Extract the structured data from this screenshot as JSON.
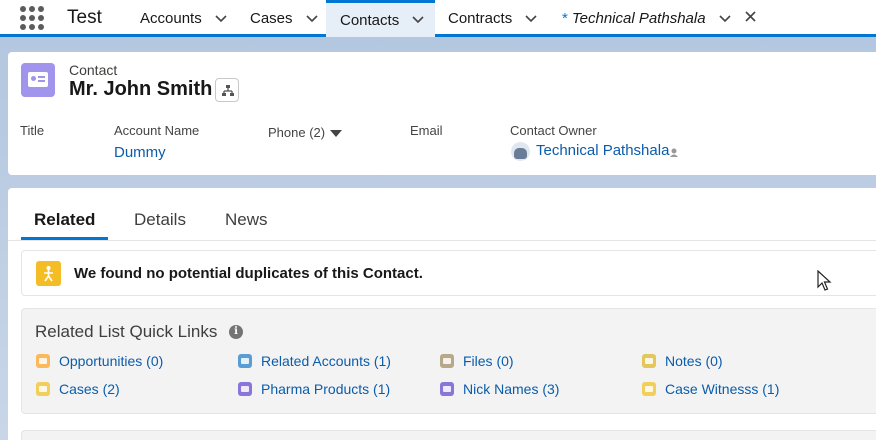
{
  "nav": {
    "app_name": "Test",
    "tabs": [
      {
        "label": "Accounts"
      },
      {
        "label": "Cases"
      },
      {
        "label": "Contacts"
      },
      {
        "label": "Contracts"
      },
      {
        "label": "Technical Pathshala",
        "prefix": "*"
      }
    ]
  },
  "header": {
    "object_type": "Contact",
    "record_name": "Mr. John Smith",
    "fields": {
      "title_label": "Title",
      "account_label": "Account Name",
      "account_value": "Dummy",
      "phone_label": "Phone (2)",
      "email_label": "Email",
      "owner_label": "Contact Owner",
      "owner_value": "Technical Pathshala"
    }
  },
  "main": {
    "tabs": [
      {
        "label": "Related"
      },
      {
        "label": "Details"
      },
      {
        "label": "News"
      }
    ],
    "duplicates_message": "We found no potential duplicates of this Contact.",
    "quick_links": {
      "title": "Related List Quick Links",
      "info_glyph": "i",
      "links": [
        {
          "label": "Opportunities (0)",
          "color": "#fcb95b"
        },
        {
          "label": "Cases (2)",
          "color": "#f2cf5b"
        },
        {
          "label": "Related Accounts (1)",
          "color": "#5a9cd4"
        },
        {
          "label": "Pharma Products (1)",
          "color": "#8a76d9"
        },
        {
          "label": "Files (0)",
          "color": "#b8a88a"
        },
        {
          "label": "Nick Names (3)",
          "color": "#8a76d9"
        },
        {
          "label": "Notes (0)",
          "color": "#e3c75b"
        },
        {
          "label": "Case Witnesss (1)",
          "color": "#f2cf5b"
        }
      ]
    }
  },
  "colors": {
    "brand": "#0176d3",
    "link": "#0b5cab",
    "contact_icon": "#a094ed",
    "warning_icon": "#f4bc25"
  }
}
